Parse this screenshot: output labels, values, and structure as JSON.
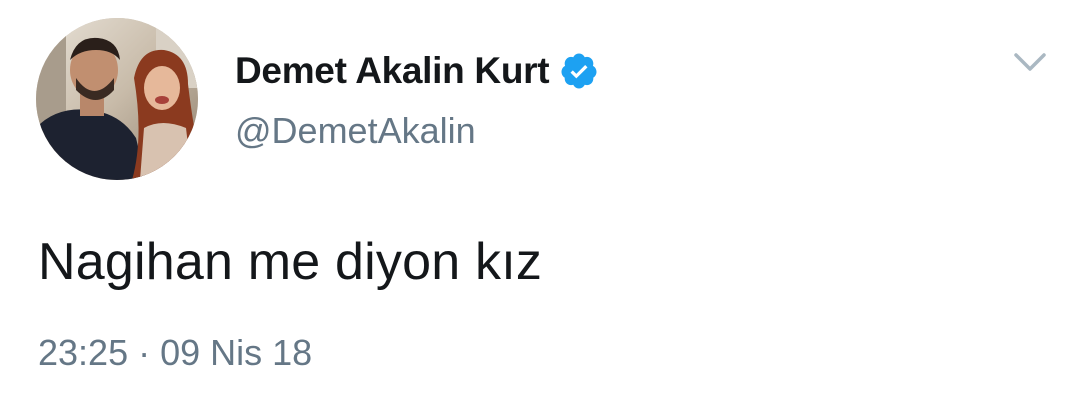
{
  "author": {
    "display_name": "Demet Akalin Kurt",
    "handle": "@DemetAkalin",
    "verified_icon": "verified-badge-icon",
    "avatar": "profile-photo"
  },
  "menu": {
    "icon": "chevron-down-icon"
  },
  "tweet": {
    "text": "Nagihan me diyon kız",
    "time": "23:25",
    "separator": "·",
    "date": "09 Nis 18"
  },
  "colors": {
    "name": "#14171a",
    "secondary": "#657786",
    "verified": "#1da1f2",
    "caret": "#aab8c2"
  }
}
